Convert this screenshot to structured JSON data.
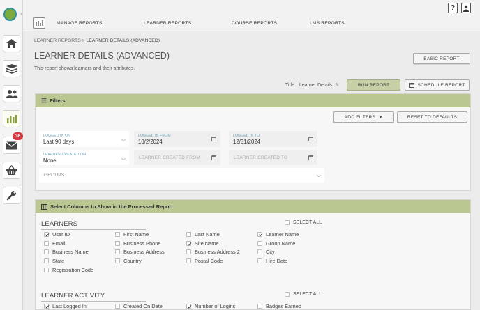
{
  "nav": [
    "MANAGE REPORTS",
    "LEARNER REPORTS",
    "COURSE REPORTS",
    "LMS REPORTS"
  ],
  "topbar": {
    "help_label": "?"
  },
  "sidebar": {
    "items": [
      "home-icon",
      "courses-icon",
      "users-icon",
      "reports-icon",
      "messages-icon",
      "store-icon",
      "tools-icon"
    ],
    "message_count": "36"
  },
  "breadcrumb": {
    "root": "LEARNER REPORTS",
    "sep": ">",
    "current": "LEARNER DETAILS (ADVANCED)"
  },
  "page": {
    "title": "LEARNER DETAILS (ADVANCED)",
    "subtitle": "This report shows learners and their attributes."
  },
  "actions": {
    "basic_report": "BASIC REPORT",
    "title_label": "Title:",
    "title_value": "Learner Details",
    "run_report": "RUN REPORT",
    "schedule_report": "SCHEDULE REPORT"
  },
  "filters": {
    "header": "Filters",
    "add_filters": "ADD FILTERS",
    "reset": "RESET TO DEFAULTS",
    "logged_in_on": {
      "label": "LOGGED IN ON",
      "value": "Last 90 days"
    },
    "logged_in_from": {
      "label": "LOGGED IN FROM",
      "value": "10/2/2024"
    },
    "logged_in_to": {
      "label": "LOGGED IN TO",
      "value": "12/31/2024"
    },
    "learner_created_on": {
      "label": "LEARNER CREATED ON",
      "value": "None"
    },
    "learner_created_from": {
      "placeholder": "LEARNER CREATED FROM"
    },
    "learner_created_to": {
      "placeholder": "LEARNER CREATED TO"
    },
    "groups": {
      "placeholder": "GROUPS"
    }
  },
  "columns": {
    "header": "Select Columns to Show in the Processed Report",
    "select_all": "SELECT ALL",
    "learners": {
      "title": "LEARNERS",
      "options": [
        {
          "label": "User ID",
          "checked": true
        },
        {
          "label": "First Name",
          "checked": false
        },
        {
          "label": "Last Name",
          "checked": false
        },
        {
          "label": "Learner Name",
          "checked": true
        },
        {
          "label": "Email",
          "checked": false
        },
        {
          "label": "Business Phone",
          "checked": false
        },
        {
          "label": "Site Name",
          "checked": true
        },
        {
          "label": "Group Name",
          "checked": false
        },
        {
          "label": "Business Name",
          "checked": false
        },
        {
          "label": "Business Address",
          "checked": false
        },
        {
          "label": "Business Address 2",
          "checked": false
        },
        {
          "label": "City",
          "checked": false
        },
        {
          "label": "State",
          "checked": false
        },
        {
          "label": "Country",
          "checked": false
        },
        {
          "label": "Postal Code",
          "checked": false
        },
        {
          "label": "Hire Date",
          "checked": false
        },
        {
          "label": "Registration Code",
          "checked": false
        }
      ]
    },
    "activity": {
      "title": "LEARNER ACTIVITY",
      "options": [
        {
          "label": "Last Logged In",
          "checked": true
        },
        {
          "label": "Created On Date",
          "checked": false
        },
        {
          "label": "Number of Logins",
          "checked": true
        },
        {
          "label": "Badges Earned",
          "checked": false
        }
      ]
    }
  }
}
